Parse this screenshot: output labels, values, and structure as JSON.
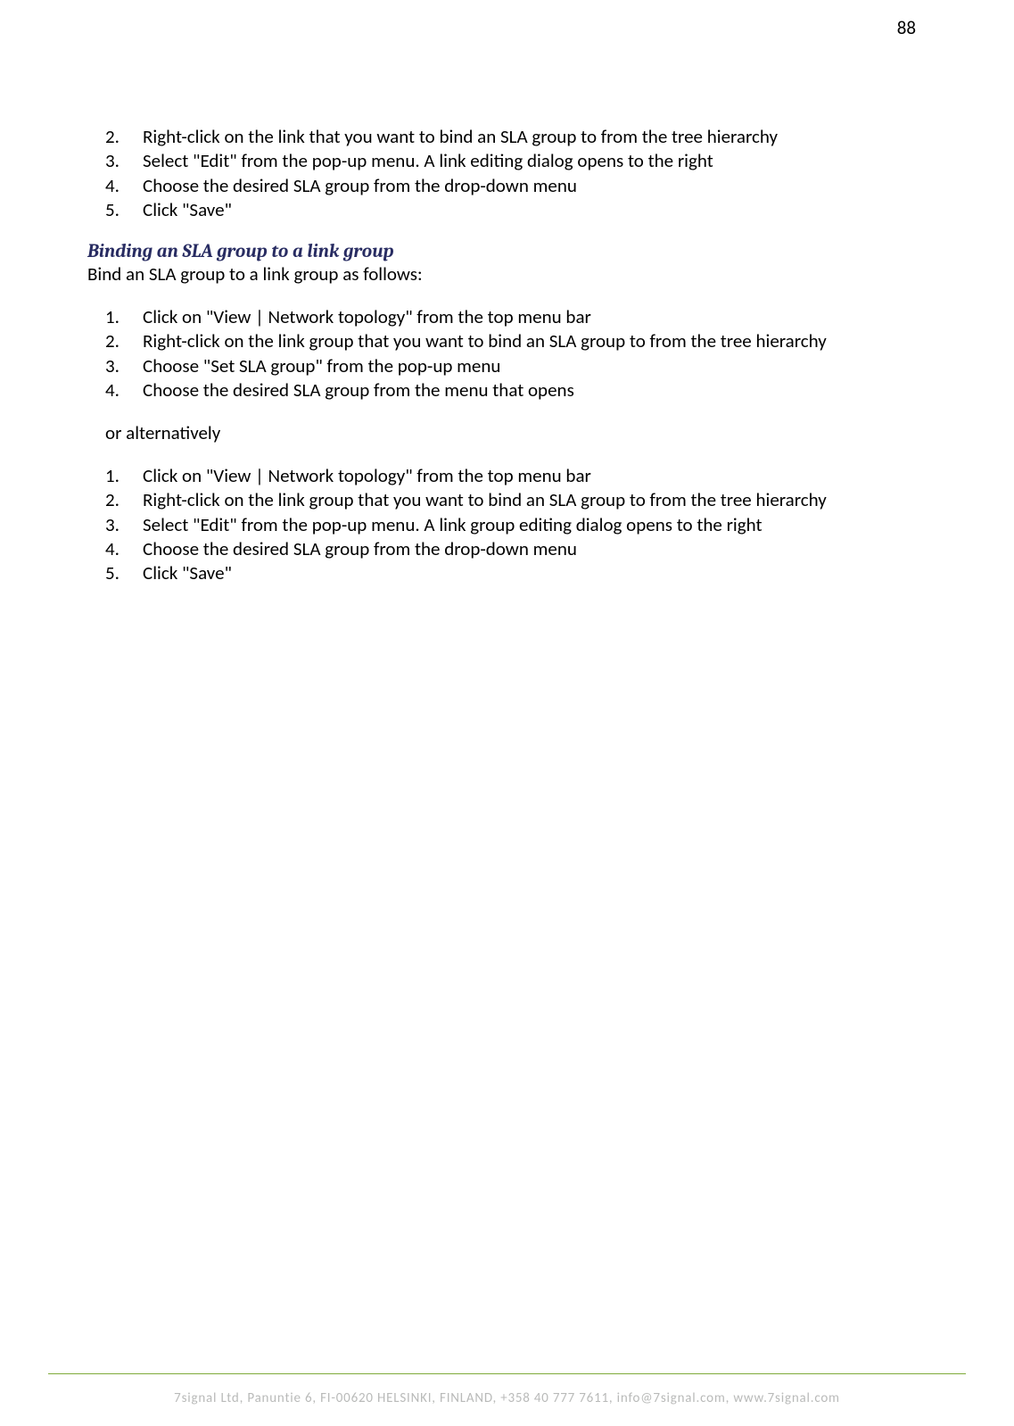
{
  "page_number": "88",
  "list1": {
    "start": 2,
    "items": [
      "Right-click on the link that you want to bind an SLA group to from the tree hierarchy",
      "Select \"Edit\" from the pop-up menu. A link editing dialog opens to the right",
      "Choose the desired SLA group from the drop-down menu",
      "Click \"Save\""
    ]
  },
  "section_heading": "Binding an SLA group to a link group",
  "intro_text": "Bind an SLA group to a link group as follows:",
  "list2": {
    "start": 1,
    "items": [
      "Click on \"View | Network topology\" from the top menu bar",
      "Right-click on the link group that you want to bind an SLA group to from the tree hierarchy",
      "Choose \"Set SLA group\" from the pop-up menu",
      "Choose the desired SLA group from the menu that opens"
    ]
  },
  "alt_text": "or alternatively",
  "list3": {
    "start": 1,
    "items": [
      "Click on \"View | Network topology\" from the top menu bar",
      "Right-click on the link group that you want to bind an SLA group to from the tree hierarchy",
      "Select \"Edit\" from the pop-up menu. A link group editing dialog opens to the right",
      "Choose the desired SLA group from the drop-down menu",
      "Click \"Save\""
    ]
  },
  "footer_text": "7signal Ltd, Panuntie 6, FI-00620 HELSINKI, FINLAND, +358 40 777 7611, info@7signal.com, www.7signal.com"
}
